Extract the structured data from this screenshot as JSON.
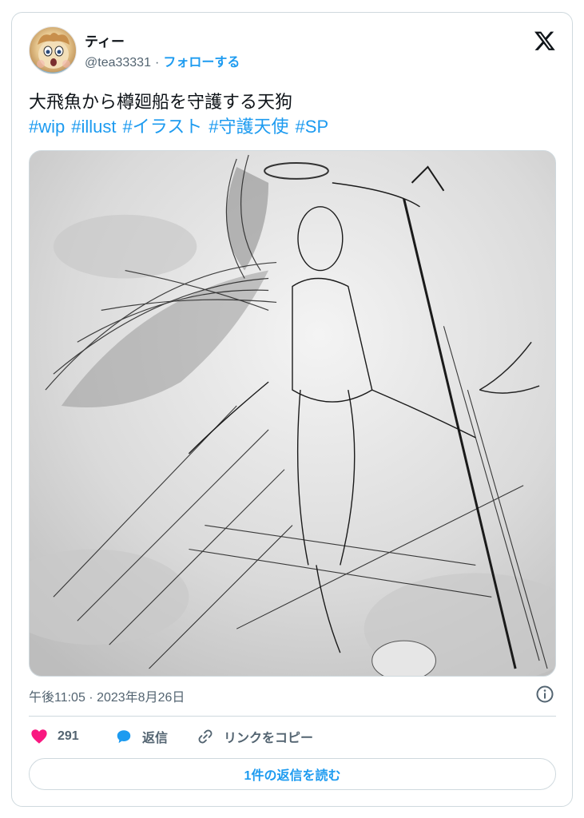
{
  "author": {
    "name": "ティー",
    "handle": "@tea33331",
    "separator": "·",
    "follow_label": "フォローする"
  },
  "tweet": {
    "text": "大飛魚から樽廻船を守護する天狗",
    "hashtags": [
      "#wip",
      "#illust",
      "#イラスト",
      "#守護天使",
      "#SP"
    ],
    "image_alt": "sketch-of-winged-tengu-guardian"
  },
  "meta": {
    "timestamp": "午後11:05 · 2023年8月26日"
  },
  "actions": {
    "like_count": "291",
    "reply_label": "返信",
    "copy_link_label": "リンクをコピー"
  },
  "read_replies_label": "1件の返信を読む",
  "icons": {
    "logo": "x-logo-icon",
    "info": "info-icon",
    "like": "heart-icon",
    "reply": "speech-bubble-icon",
    "link": "link-icon"
  },
  "colors": {
    "accent": "#1d9bf0",
    "like": "#f91880",
    "text": "#0f1419",
    "muted": "#536471",
    "border": "#cfd9de"
  }
}
